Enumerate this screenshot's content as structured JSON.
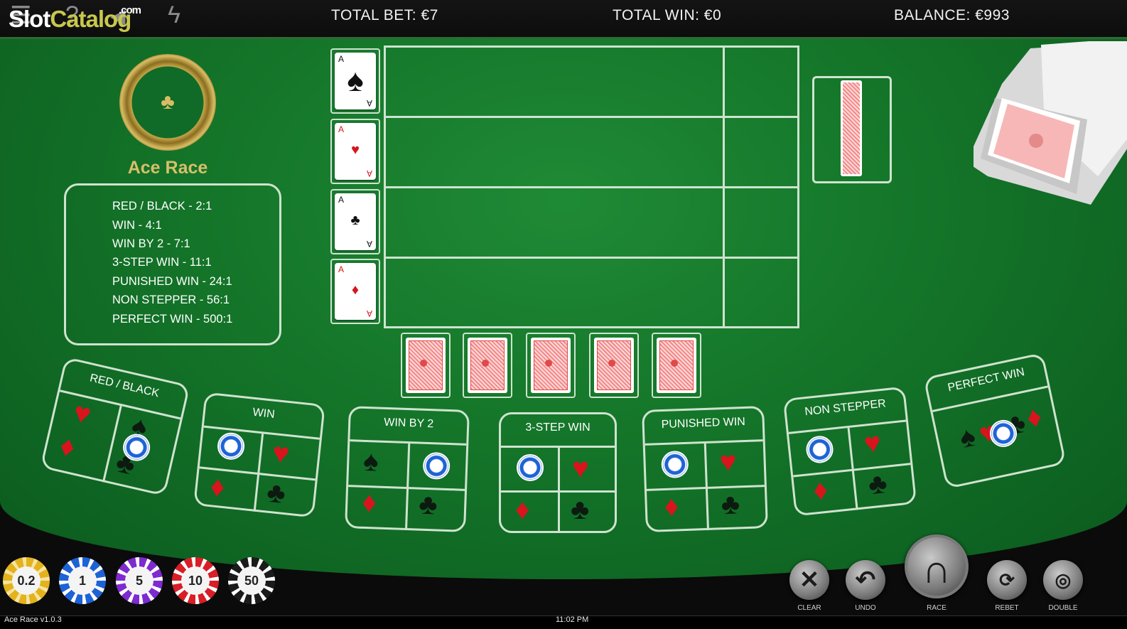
{
  "header": {
    "logo_main": "Slot",
    "logo_accent": "Catalog",
    "logo_suffix": ".com",
    "total_bet_label": "TOTAL BET:",
    "total_bet_value": "€7",
    "total_win_label": "TOTAL WIN:",
    "total_win_value": "€0",
    "balance_label": "BALANCE:",
    "balance_value": "€993",
    "icons": [
      "menu-icon",
      "help-icon",
      "sound-icon",
      "turbo-icon"
    ]
  },
  "game": {
    "title": "Ace Race",
    "paytable": [
      "RED / BLACK - 2:1",
      "WIN - 4:1",
      "WIN BY 2 - 7:1",
      "3-STEP WIN - 11:1",
      "PUNISHED WIN - 24:1",
      "NON STEPPER - 56:1",
      "PERFECT WIN - 500:1"
    ]
  },
  "aces": [
    {
      "rank": "A",
      "suit": "♠",
      "color": "black"
    },
    {
      "rank": "A",
      "suit": "♥",
      "color": "red"
    },
    {
      "rank": "A",
      "suit": "♣",
      "color": "black"
    },
    {
      "rank": "A",
      "suit": "♦",
      "color": "red"
    }
  ],
  "bets": [
    {
      "label": "RED / BLACK",
      "has_chip": true
    },
    {
      "label": "WIN",
      "has_chip": true
    },
    {
      "label": "WIN BY 2",
      "has_chip": true
    },
    {
      "label": "3-STEP WIN",
      "has_chip": true
    },
    {
      "label": "PUNISHED WIN",
      "has_chip": true
    },
    {
      "label": "NON STEPPER",
      "has_chip": true
    },
    {
      "label": "PERFECT WIN",
      "has_chip": true
    }
  ],
  "chips": [
    {
      "value": "0.2",
      "color": "#e3b21c"
    },
    {
      "value": "1",
      "color": "#1e63d6"
    },
    {
      "value": "5",
      "color": "#7d2ad0"
    },
    {
      "value": "10",
      "color": "#d81e26"
    },
    {
      "value": "50",
      "color": "#1b1b1b"
    }
  ],
  "controls": {
    "clear": "CLEAR",
    "undo": "UNDO",
    "race": "RACE",
    "rebet": "REBET",
    "double": "DOUBLE"
  },
  "footer": {
    "version": "Ace Race v1.0.3",
    "time": "11:02 PM"
  },
  "colors": {
    "felt": "#147529",
    "lines": "#cfe3cf",
    "gold": "#d7bf6a"
  }
}
